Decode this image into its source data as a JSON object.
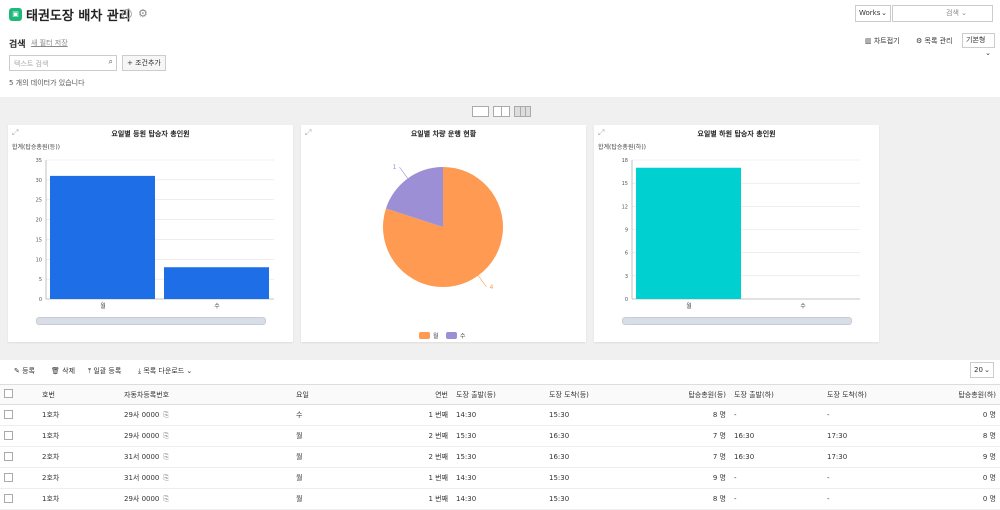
{
  "header": {
    "app_icon": "▣",
    "title": "태권도장 배차 관리",
    "info_icon": "i",
    "gear_icon": "⚙"
  },
  "topright": {
    "works_select": "Works",
    "search_placeholder": "검색"
  },
  "filters": {
    "search_tab": "검색",
    "save_filter": "새 필터 저장",
    "text_search_placeholder": "텍스트 검색",
    "add_condition": "조건추가",
    "result_count": "5 개의 데이터가 있습니다"
  },
  "actions": {
    "chart_collapse": "차트접기",
    "list_manage": "목록 관리",
    "view_select": "기본형"
  },
  "charts": [
    {
      "title": "요일별 등원 탑승자 총인원",
      "ylabel": "합계(탑승총원(등))"
    },
    {
      "title": "요일별 차량 운행 현황"
    },
    {
      "title": "요일별 하원 탑승자 총인원",
      "ylabel": "합계(탑승총원(하))"
    }
  ],
  "chart_data": [
    {
      "type": "bar",
      "title": "요일별 등원 탑승자 총인원",
      "ylabel": "합계(탑승총원(등))",
      "categories": [
        "월",
        "수"
      ],
      "values": [
        31,
        8
      ],
      "ylim": [
        0,
        35
      ],
      "yticks": [
        0,
        5,
        10,
        15,
        20,
        25,
        30,
        35
      ],
      "color": "#1e6ee8"
    },
    {
      "type": "pie",
      "title": "요일별 차량 운행 현황",
      "categories": [
        "월",
        "수"
      ],
      "values": [
        4,
        1
      ],
      "colors": [
        "#ff9a52",
        "#9d8fd5"
      ],
      "legend": "bottom"
    },
    {
      "type": "bar",
      "title": "요일별 하원 탑승자 총인원",
      "ylabel": "합계(탑승총원(하))",
      "categories": [
        "월",
        "수"
      ],
      "values": [
        17,
        0
      ],
      "ylim": [
        0,
        18
      ],
      "yticks": [
        0,
        3,
        6,
        9,
        12,
        15,
        18
      ],
      "color": "#00d0cf"
    }
  ],
  "toolbar": {
    "register": "등록",
    "delete": "삭제",
    "bulk_register": "일괄 등록",
    "list_download": "목록 다운로드",
    "page_size": "20"
  },
  "table": {
    "headers": [
      "호번",
      "자동차등록번호",
      "요일",
      "연번",
      "도장 출발(등)",
      "도장 도착(등)",
      "탑승총원(등)",
      "도장 출발(하)",
      "도장 도착(하)",
      "탑승총원(하)"
    ],
    "rows": [
      [
        "1호차",
        "29사 0000",
        "수",
        "1 번째",
        "14:30",
        "15:30",
        "8 명",
        "-",
        "-",
        "0 명"
      ],
      [
        "1호차",
        "29사 0000",
        "월",
        "2 번째",
        "15:30",
        "16:30",
        "7 명",
        "16:30",
        "17:30",
        "8 명"
      ],
      [
        "2호차",
        "31서 0000",
        "월",
        "2 번째",
        "15:30",
        "16:30",
        "7 명",
        "16:30",
        "17:30",
        "9 명"
      ],
      [
        "2호차",
        "31서 0000",
        "월",
        "1 번째",
        "14:30",
        "15:30",
        "9 명",
        "-",
        "-",
        "0 명"
      ],
      [
        "1호차",
        "29사 0000",
        "월",
        "1 번째",
        "14:30",
        "15:30",
        "8 명",
        "-",
        "-",
        "0 명"
      ]
    ]
  }
}
